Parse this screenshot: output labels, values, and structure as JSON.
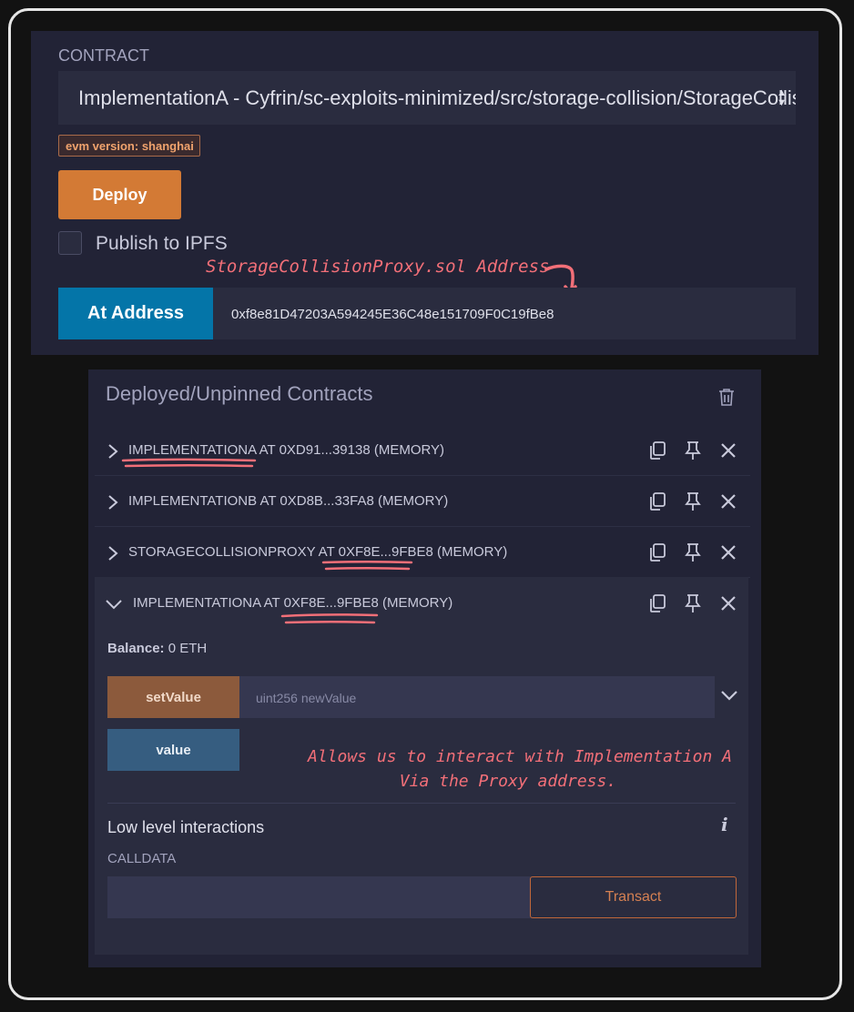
{
  "contract": {
    "label": "CONTRACT",
    "selected": "ImplementationA - Cyfrin/sc-exploits-minimized/src/storage-collision/StorageCollision.sol",
    "evm_badge": "evm version: shanghai"
  },
  "deploy": {
    "label": "Deploy"
  },
  "ipfs": {
    "label": "Publish to IPFS",
    "checked": false
  },
  "at_address": {
    "label": "At Address",
    "value": "0xf8e81D47203A594245E36C48e151709F0C19fBe8",
    "annotation": "StorageCollisionProxy.sol Address"
  },
  "deployed": {
    "title": "Deployed/Unpinned Contracts",
    "instances": [
      {
        "label": "IMPLEMENTATIONA AT 0XD91...39138 (MEMORY)",
        "expanded": false
      },
      {
        "label": "IMPLEMENTATIONB AT 0XD8B...33FA8 (MEMORY)",
        "expanded": false
      },
      {
        "label": "STORAGECOLLISIONPROXY AT 0XF8E...9FBE8 (MEMORY)",
        "expanded": false
      },
      {
        "label": "IMPLEMENTATIONA AT 0XF8E...9FBE8 (MEMORY)",
        "expanded": true
      }
    ]
  },
  "expanded": {
    "balance_label": "Balance:",
    "balance_value": "0 ETH",
    "setvalue_label": "setValue",
    "setvalue_placeholder": "uint256 newValue",
    "value_label": "value",
    "annotation_line1": "Allows us to interact with Implementation A",
    "annotation_line2": "Via the Proxy address.",
    "low_level_title": "Low level interactions",
    "calldata_label": "CALLDATA",
    "transact_label": "Transact"
  },
  "colors": {
    "accent_orange": "#d37a35",
    "accent_blue": "#0475a8",
    "annotation_red": "#f26f78"
  }
}
